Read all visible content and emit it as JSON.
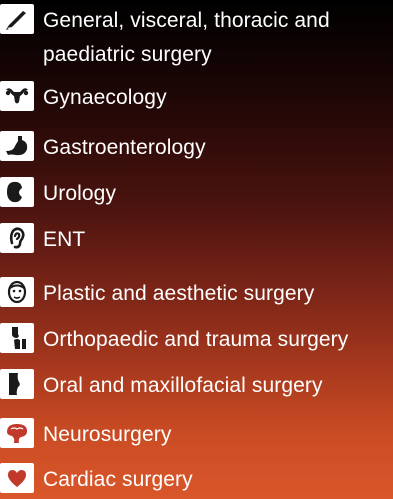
{
  "specialties": [
    {
      "icon": "scalpel-icon",
      "label": "General, visceral, thoracic and paediatric surgery"
    },
    {
      "icon": "uterus-icon",
      "label": "Gynaecology"
    },
    {
      "icon": "stomach-icon",
      "label": "Gastroenterology"
    },
    {
      "icon": "kidney-icon",
      "label": "Urology"
    },
    {
      "icon": "ear-icon",
      "label": "ENT"
    },
    {
      "icon": "face-icon",
      "label": "Plastic and aesthetic surgery"
    },
    {
      "icon": "knee-joint-icon",
      "label": "Orthopaedic and trauma surgery"
    },
    {
      "icon": "jaw-icon",
      "label": "Oral and maxillofacial surgery"
    },
    {
      "icon": "brain-icon",
      "label": "Neurosurgery"
    },
    {
      "icon": "heart-icon",
      "label": "Cardiac surgery"
    }
  ],
  "colors": {
    "icon_background": "#ffffff",
    "icon_glyph": "#1a1a1a",
    "icon_accent": "#c0392b",
    "text": "#ffffff"
  }
}
